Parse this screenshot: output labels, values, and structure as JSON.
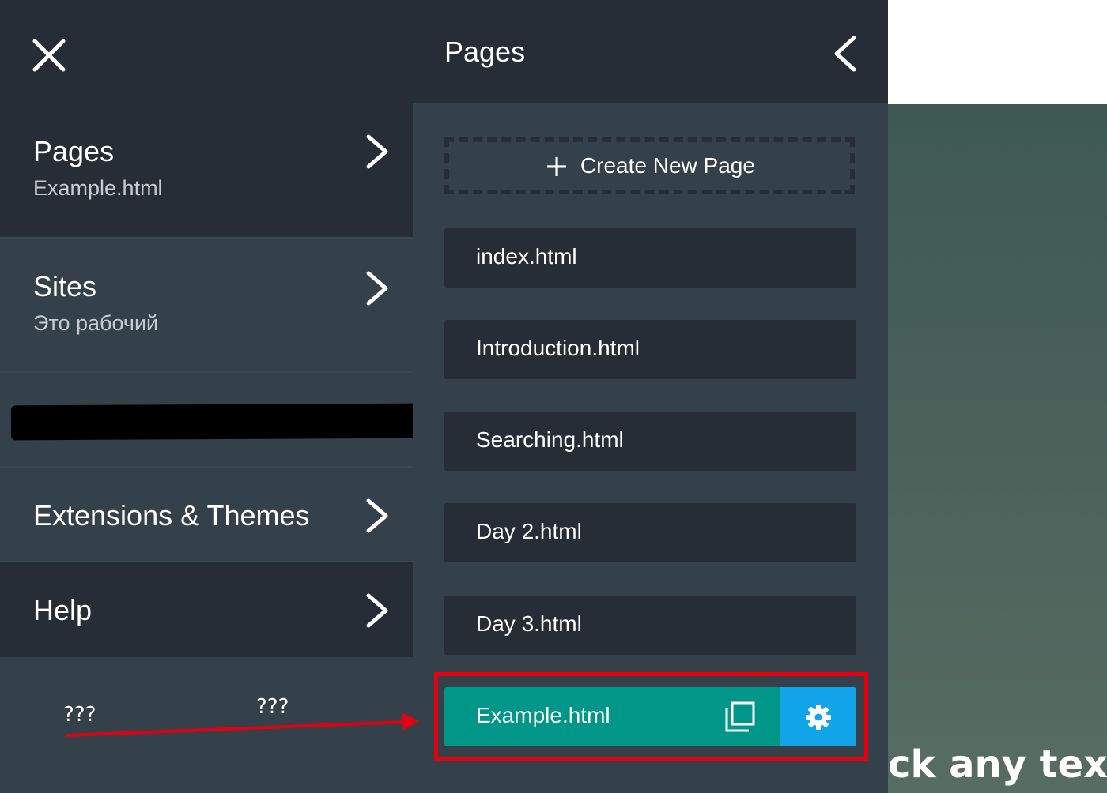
{
  "left_menu": {
    "items": [
      {
        "title": "Pages",
        "subtitle": "Example.html"
      },
      {
        "title": "Sites",
        "subtitle": "Это рабочий"
      },
      {
        "title": "Extensions & Themes"
      },
      {
        "title": "Help"
      }
    ],
    "annotation": {
      "label_1": "???",
      "label_2": "???"
    }
  },
  "pages_panel": {
    "title": "Pages",
    "create_label": "Create New Page",
    "pages": [
      "index.html",
      "Introduction.html",
      "Searching.html",
      "Day 2.html",
      "Day 3.html"
    ],
    "active_page": "Example.html"
  },
  "canvas": {
    "text": "ck any text"
  },
  "colors": {
    "header_dark": "#262d36",
    "panel": "#34404a",
    "active_teal": "#009688",
    "settings_blue": "#12a4e8",
    "annotation_red": "#e3000f"
  },
  "icons": {
    "close": "close-icon",
    "chevron": "chevron-right-icon",
    "back": "chevron-left-icon",
    "plus": "plus-icon",
    "duplicate": "duplicate-icon",
    "settings": "gear-icon"
  }
}
